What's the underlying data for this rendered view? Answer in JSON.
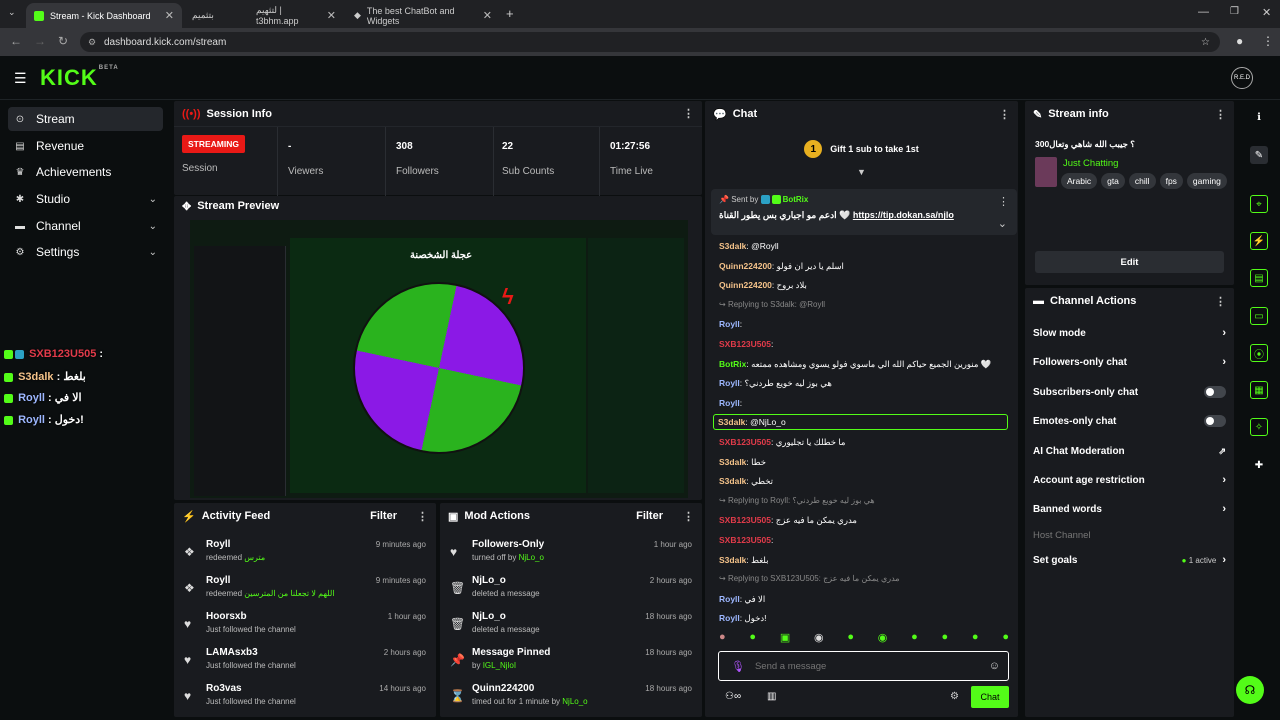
{
  "browser": {
    "tabs": [
      {
        "label": "Stream - Kick Dashboard",
        "active": true
      },
      {
        "label": "ﺑﺘﺜﻤﻴﻢ"
      },
      {
        "label": "ﻟﺘﺜﻬﻴﻢ | t3bhm.app"
      },
      {
        "label": "The best ChatBot and Widgets"
      }
    ],
    "url": "dashboard.kick.com/stream"
  },
  "header": {
    "logo": "KICK",
    "logo_badge": "BETA",
    "avatar_initials": "R.E.D"
  },
  "sidebar": {
    "items": [
      {
        "label": "Stream",
        "icon": "stream-icon",
        "active": true
      },
      {
        "label": "Revenue",
        "icon": "revenue-icon"
      },
      {
        "label": "Achievements",
        "icon": "trophy-icon"
      },
      {
        "label": "Studio",
        "icon": "studio-icon",
        "expand": true
      },
      {
        "label": "Channel",
        "icon": "channel-icon",
        "expand": true
      },
      {
        "label": "Settings",
        "icon": "gear-icon",
        "expand": true
      }
    ]
  },
  "overlay_chat": [
    {
      "user": "SXB123U505",
      "text": ":",
      "color": "#e23b4a"
    },
    {
      "user": "S3dalk",
      "text": ": بلغط",
      "color": "#f5c38a"
    },
    {
      "user": "Royll",
      "text": ": الا في",
      "color": "#9db7ff"
    },
    {
      "user": "Royll",
      "text": ": دخول!",
      "color": "#9db7ff"
    }
  ],
  "session": {
    "title": "Session Info",
    "status": "STREAMING",
    "session_label": "Session",
    "stats": [
      {
        "value": "-",
        "label": "Viewers"
      },
      {
        "value": "308",
        "label": "Followers"
      },
      {
        "value": "22",
        "label": "Sub Counts"
      },
      {
        "value": "01:27:56",
        "label": "Time Live"
      }
    ]
  },
  "preview": {
    "title": "Stream Preview",
    "wheel_title": "عجلة الشخصنة"
  },
  "activity": {
    "title": "Activity Feed",
    "filter": "Filter",
    "items": [
      {
        "icon": "gift-icon",
        "name": "Royll",
        "sub": "redeemed",
        "extra": "مترس",
        "time": "9 minutes ago"
      },
      {
        "icon": "gift-icon",
        "name": "Royll",
        "sub": "redeemed",
        "extra": "اللهم لا تجعلنا من المترسين",
        "time": "9 minutes ago"
      },
      {
        "icon": "heart-icon",
        "name": "Hoorsxb",
        "sub": "Just followed the channel",
        "extra": "",
        "time": "1 hour ago"
      },
      {
        "icon": "heart-icon",
        "name": "LAMAsxb3",
        "sub": "Just followed the channel",
        "extra": "",
        "time": "2 hours ago"
      },
      {
        "icon": "heart-icon",
        "name": "Ro3vas",
        "sub": "Just followed the channel",
        "extra": "",
        "time": "14 hours ago"
      }
    ]
  },
  "mod": {
    "title": "Mod Actions",
    "filter": "Filter",
    "items": [
      {
        "icon": "heart-icon",
        "name": "Followers-Only",
        "sub": "turned off by",
        "extra": "NjLo_o",
        "time": "1 hour ago"
      },
      {
        "icon": "trash-icon",
        "name": "NjLo_o",
        "sub": "deleted a message",
        "extra": "",
        "time": "2 hours ago"
      },
      {
        "icon": "trash-icon",
        "name": "NjLo_o",
        "sub": "deleted a message",
        "extra": "",
        "time": "18 hours ago"
      },
      {
        "icon": "pin-icon",
        "name": "Message Pinned",
        "sub": "by",
        "extra": "IGL_NjloI",
        "time": "18 hours ago"
      },
      {
        "icon": "hourglass-icon",
        "name": "Quinn224200",
        "sub": "timed out for 1 minute by",
        "extra": "NjLo_o",
        "time": "18 hours ago"
      }
    ]
  },
  "chat": {
    "title": "Chat",
    "gift_text": "Gift 1 sub to take 1st",
    "gift_rank": "1",
    "pinned": {
      "sent_by": "Sent by",
      "bot": "BotRix",
      "text": "ادعم مو اجباري بس يطور القناة 🤍",
      "link": "https://tip.dokan.sa/njlo"
    },
    "messages": [
      {
        "u": "S3dalk",
        "c": "u-y",
        "t": ": @Royll"
      },
      {
        "u": "Quinn224200",
        "c": "u-y",
        "t": ": اسلم يا دير ان فولو"
      },
      {
        "u": "Quinn224200",
        "c": "u-y",
        "t": ": بلاد بروح"
      },
      {
        "reply": "Replying to S3dalk: @Royll"
      },
      {
        "u": "Royll",
        "c": "u-b",
        "t": ":"
      },
      {
        "u": "SXB123U505",
        "c": "u-r",
        "t": ":"
      },
      {
        "u": "BotRix",
        "c": "u-g",
        "t": ": منورين الجميع حياكم الله الي ماسوي فولو يسوي ومشاهده ممتعه 🤍"
      },
      {
        "u": "Royll",
        "c": "u-b",
        "t": ": هي بوز ليه خويع طردني؟"
      },
      {
        "u": "Royll",
        "c": "u-b",
        "t": ":"
      },
      {
        "u": "S3dalk",
        "c": "u-y",
        "t": ": @NjLo_o",
        "hl": true
      },
      {
        "u": "SXB123U505",
        "c": "u-r",
        "t": ": ما خطلك يا تجليوري"
      },
      {
        "u": "S3dalk",
        "c": "u-y",
        "t": ": خطا"
      },
      {
        "u": "S3dalk",
        "c": "u-y",
        "t": ": تخطي"
      },
      {
        "reply": "Replying to Royll: هي بوز ليه خويع طردني؟"
      },
      {
        "u": "SXB123U505",
        "c": "u-r",
        "t": ": مدري يمكن ما فيه عزج"
      },
      {
        "u": "SXB123U505",
        "c": "u-r",
        "t": ":"
      },
      {
        "u": "S3dalk",
        "c": "u-y",
        "t": ": بلغط"
      },
      {
        "reply": "Replying to SXB123U505: مدري يمكن ما فيه عزج"
      },
      {
        "u": "Royll",
        "c": "u-b",
        "t": ": الا في"
      },
      {
        "u": "Royll",
        "c": "u-b",
        "t": ": دخول!"
      }
    ],
    "placeholder": "Send a message",
    "send": "Chat"
  },
  "stream_info": {
    "title": "Stream info",
    "stream_title": "300؟ جيبب الله شاهي وتعال",
    "category": "Just Chatting",
    "tags": [
      "Arabic",
      "gta",
      "chill",
      "fps",
      "gaming"
    ],
    "edit": "Edit"
  },
  "channel_actions": {
    "title": "Channel Actions",
    "items": [
      {
        "label": "Slow mode",
        "kind": "chev"
      },
      {
        "label": "Followers-only chat",
        "kind": "chev"
      },
      {
        "label": "Subscribers-only chat",
        "kind": "toggle"
      },
      {
        "label": "Emotes-only chat",
        "kind": "toggle"
      },
      {
        "label": "AI Chat Moderation",
        "kind": "ext"
      },
      {
        "label": "Account age restriction",
        "kind": "chev"
      },
      {
        "label": "Banned words",
        "kind": "chev"
      },
      {
        "label": "Host Channel",
        "kind": "none",
        "muted": true
      },
      {
        "label": "Set goals",
        "kind": "chev",
        "status": "1 active"
      }
    ]
  },
  "colors": {
    "accent": "#53fc18",
    "live": "#e91916",
    "panel": "#191b1f",
    "bg": "#0b0e0f"
  }
}
